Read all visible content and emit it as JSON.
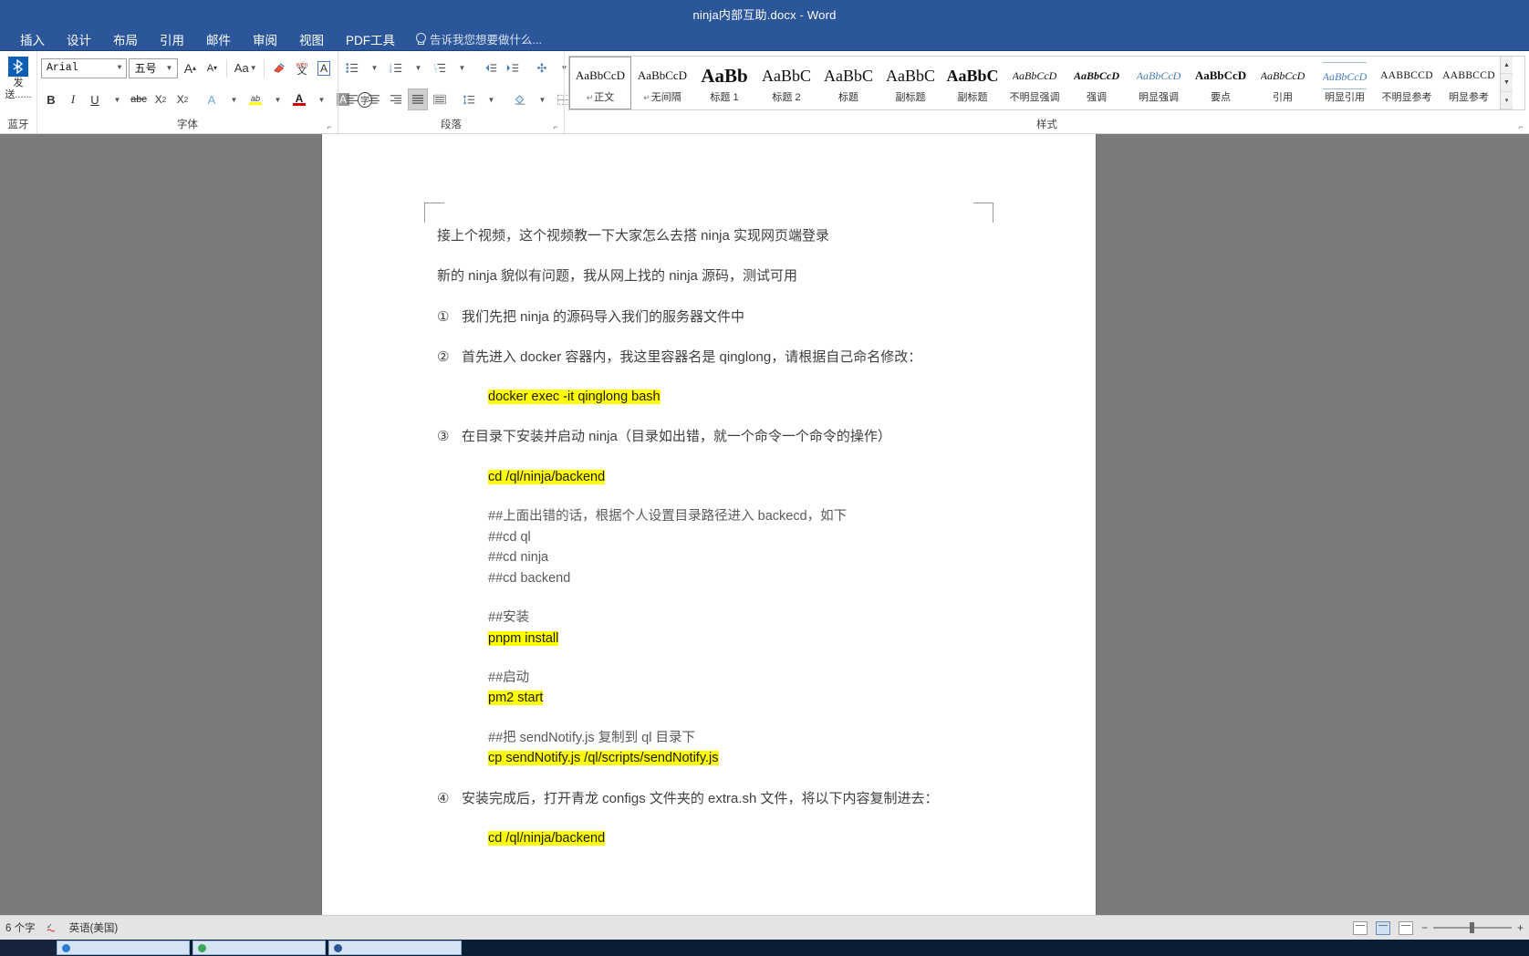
{
  "window": {
    "title": "ninja内部互助.docx - Word"
  },
  "ribbon": {
    "tabs": [
      {
        "label": "插入"
      },
      {
        "label": "设计"
      },
      {
        "label": "布局"
      },
      {
        "label": "引用"
      },
      {
        "label": "邮件"
      },
      {
        "label": "审阅"
      },
      {
        "label": "视图"
      },
      {
        "label": "PDF工具"
      }
    ],
    "tell_me": "告诉我您想要做什么...",
    "bluetooth": {
      "label_line1": "发",
      "label_line2": "送......",
      "group_label": "蓝牙",
      "glyph": "ᛒ"
    },
    "font_group": {
      "label": "字体",
      "font_name": "Arial",
      "font_size": "五号",
      "grow_font": "A",
      "shrink_font": "A",
      "change_case": "Aa",
      "clear_format": "✐",
      "phonetic": "wén",
      "phonetic_sub": "文",
      "char_border": "A",
      "bold": "B",
      "italic": "I",
      "underline": "U",
      "strikethrough": "abc",
      "subscript": "X",
      "superscript": "X",
      "text_effects": "A",
      "highlight": "ab",
      "font_color": "A",
      "char_shading": "A",
      "enclose_char": "字"
    },
    "paragraph_group": {
      "label": "段落",
      "bullets": "☰",
      "numbering": "☰",
      "multilevel": "☰",
      "decrease_indent": "⬅",
      "increase_indent": "➡",
      "sort": "A↓",
      "show_marks": "¶",
      "align_left": "≡",
      "align_center": "≡",
      "align_right": "≡",
      "justify": "≡",
      "distribute": "≡",
      "line_spacing": "↕",
      "shading": "■",
      "borders": "▦"
    },
    "styles_group": {
      "label": "样式",
      "items": [
        {
          "preview": "AaBbCcD",
          "name": "正文",
          "cls": "sp-normal",
          "pilcrow": true,
          "selected": true
        },
        {
          "preview": "AaBbCcD",
          "name": "无间隔",
          "cls": "sp-normal",
          "pilcrow": true,
          "selected": false
        },
        {
          "preview": "AaBb",
          "name": "标题 1",
          "cls": "sp-big",
          "pilcrow": false,
          "selected": false
        },
        {
          "preview": "AaBbC",
          "name": "标题 2",
          "cls": "sp-h2",
          "pilcrow": false,
          "selected": false
        },
        {
          "preview": "AaBbC",
          "name": "标题",
          "cls": "sp-title",
          "pilcrow": false,
          "selected": false
        },
        {
          "preview": "AaBbC",
          "name": "副标题",
          "cls": "sp-sub",
          "pilcrow": false,
          "selected": false
        },
        {
          "preview": "AaBbC",
          "name": "副标题",
          "cls": "sp-subtitle-b",
          "pilcrow": false,
          "selected": false
        },
        {
          "preview": "AaBbCcD",
          "name": "不明显强调",
          "cls": "sp-italic",
          "pilcrow": false,
          "selected": false
        },
        {
          "preview": "AaBbCcD",
          "name": "强调",
          "cls": "sp-italic-b",
          "pilcrow": false,
          "selected": false
        },
        {
          "preview": "AaBbCcD",
          "name": "明显强调",
          "cls": "sp-italic-blue",
          "pilcrow": false,
          "selected": false
        },
        {
          "preview": "AaBbCcD",
          "name": "要点",
          "cls": "sp-bold",
          "pilcrow": false,
          "selected": false
        },
        {
          "preview": "AaBbCcD",
          "name": "引用",
          "cls": "sp-italic",
          "pilcrow": false,
          "selected": false
        },
        {
          "preview": "AaBbCcD",
          "name": "明显引用",
          "cls": "sp-quote-u",
          "pilcrow": false,
          "selected": false
        },
        {
          "preview": "AABBCCD",
          "name": "不明显参考",
          "cls": "sp-smallcap",
          "pilcrow": false,
          "selected": false
        },
        {
          "preview": "AABBCCD",
          "name": "明显参考",
          "cls": "sp-smallcap",
          "pilcrow": false,
          "selected": false
        }
      ],
      "scroll_up": "▲",
      "scroll_down": "▼",
      "scroll_more": "▾"
    }
  },
  "document": {
    "paragraphs": [
      {
        "kind": "para",
        "text": "接上个视频，这个视频教一下大家怎么去搭 ninja 实现网页端登录"
      },
      {
        "kind": "para",
        "text": "新的 ninja 貌似有问题，我从网上找的 ninja 源码，测试可用"
      },
      {
        "kind": "num",
        "num": "①",
        "text": "我们先把 ninja 的源码导入我们的服务器文件中"
      },
      {
        "kind": "num",
        "num": "②",
        "text": "首先进入 docker 容器内，我这里容器名是 qinglong，请根据自己命名修改："
      },
      {
        "kind": "code",
        "text": "docker exec -it qinglong bash",
        "highlight": true
      },
      {
        "kind": "num",
        "num": "③",
        "text": "在目录下安装并启动 ninja（目录如出错，就一个命令一个命令的操作）"
      },
      {
        "kind": "code",
        "text": "cd /ql/ninja/backend",
        "highlight": true
      },
      {
        "kind": "comment",
        "text": "##上面出错的话，根据个人设置目录路径进入 backecd，如下"
      },
      {
        "kind": "comment",
        "text": "##cd ql"
      },
      {
        "kind": "comment",
        "text": "##cd ninja"
      },
      {
        "kind": "comment",
        "text": "##cd backend"
      },
      {
        "kind": "blank",
        "text": ""
      },
      {
        "kind": "comment",
        "text": "##安装"
      },
      {
        "kind": "code",
        "text": "pnpm install",
        "highlight": true
      },
      {
        "kind": "blank",
        "text": ""
      },
      {
        "kind": "comment",
        "text": "##启动"
      },
      {
        "kind": "code",
        "text": "pm2 start",
        "highlight": true
      },
      {
        "kind": "blank",
        "text": ""
      },
      {
        "kind": "comment",
        "text": "##把 sendNotify.js 复制到 ql 目录下"
      },
      {
        "kind": "code",
        "text": "cp sendNotify.js /ql/scripts/sendNotify.js",
        "highlight": true
      },
      {
        "kind": "num",
        "num": "④",
        "text": "安装完成后，打开青龙 configs 文件夹的 extra.sh 文件，将以下内容复制进去："
      },
      {
        "kind": "code",
        "text": "cd /ql/ninja/backend",
        "highlight": true
      }
    ]
  },
  "statusbar": {
    "word_count": "6 个字",
    "proofing_icon": "proofing-icon",
    "language": "英语(美国)",
    "view_read": "read-mode-icon",
    "view_print": "print-layout-icon",
    "view_web": "web-layout-icon",
    "zoom_out": "−",
    "zoom_in": "+"
  },
  "colors": {
    "accent": "#2b579a",
    "highlight": "#ffff00",
    "page": "#ffffff",
    "canvas": "#7b7b7b"
  }
}
